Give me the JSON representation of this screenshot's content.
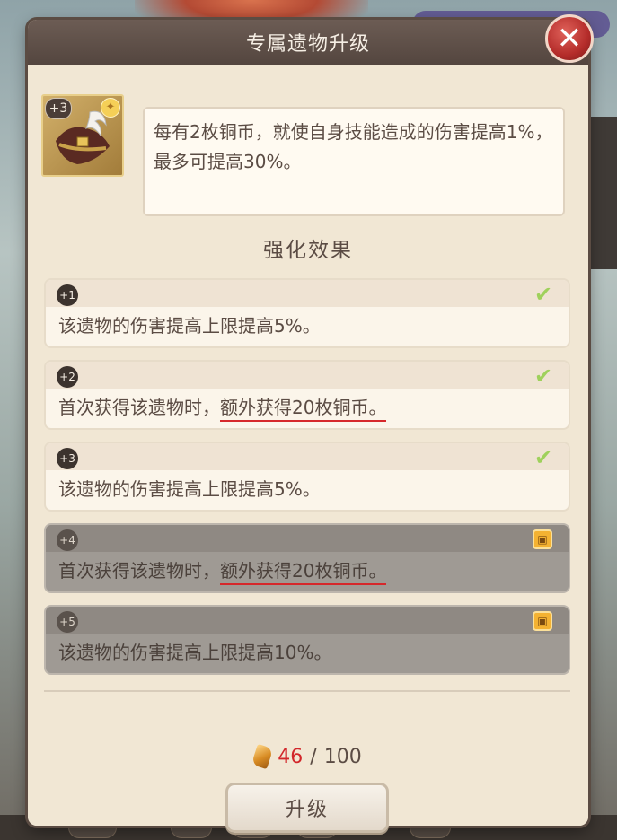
{
  "dialog": {
    "title": "专属遗物升级",
    "close_icon": "close-icon"
  },
  "relic": {
    "level": "+3",
    "description": "每有2枚铜币，就使自身技能造成的伤害提高1%，最多可提高30%。"
  },
  "effects_title": "强化效果",
  "effects": [
    {
      "level": "+1",
      "prefix": "该遗物的伤害提高上限提高5%。",
      "highlight": "",
      "locked": false,
      "icon": "check-icon"
    },
    {
      "level": "+2",
      "prefix": "首次获得该遗物时，",
      "highlight": "额外获得20枚铜币。",
      "locked": false,
      "icon": "check-icon"
    },
    {
      "level": "+3",
      "prefix": "该遗物的伤害提高上限提高5%。",
      "highlight": "",
      "locked": false,
      "icon": "check-icon"
    },
    {
      "level": "+4",
      "prefix": "首次获得该遗物时，",
      "highlight": "额外获得20枚铜币。",
      "locked": true,
      "icon": "lock-icon"
    },
    {
      "level": "+5",
      "prefix": "该遗物的伤害提高上限提高10%。",
      "highlight": "",
      "locked": true,
      "icon": "lock-icon"
    }
  ],
  "cost": {
    "have": "46",
    "separator": "/",
    "need": "100"
  },
  "upgrade_label": "升级",
  "colors": {
    "accent_red": "#d2262a",
    "check_green": "#9fd15c",
    "lock_gold": "#f4b232",
    "header": "#5b4c43"
  }
}
